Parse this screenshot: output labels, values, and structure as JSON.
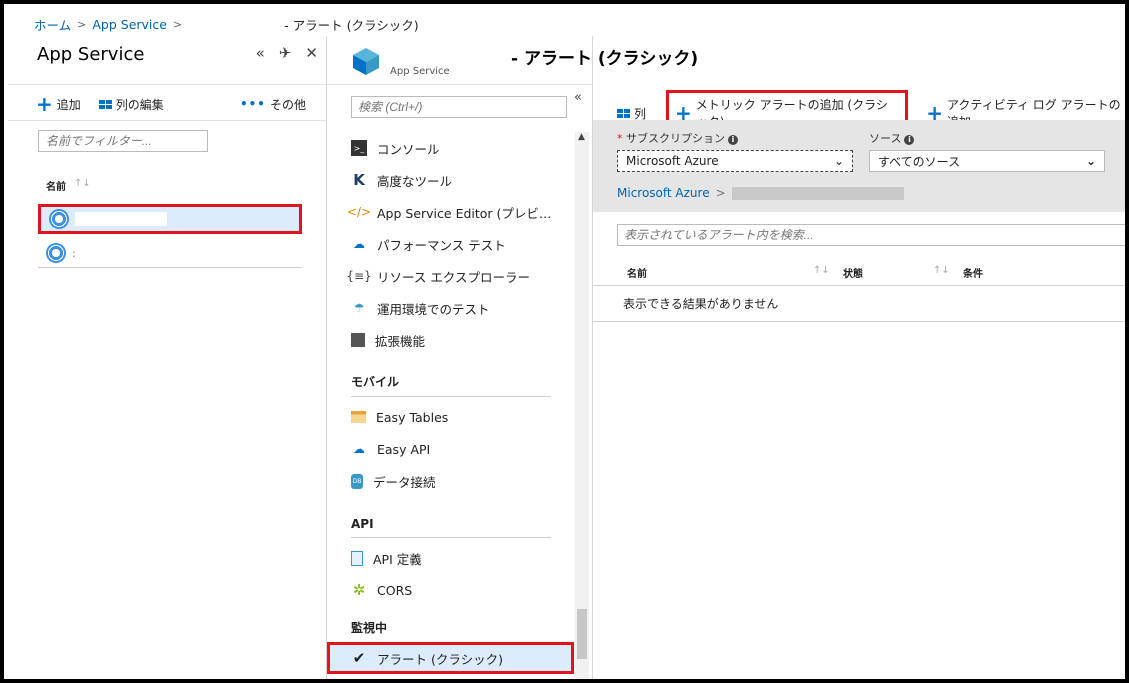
{
  "breadcrumb": {
    "home": "ホーム",
    "app_service": "App Service",
    "current": "- アラート (クラシック)"
  },
  "left_blade": {
    "title": "App Service",
    "toolbar": {
      "add": "追加",
      "edit_columns": "列の編集",
      "more": "その他"
    },
    "filter_placeholder": "名前でフィルター...",
    "column_name": "名前",
    "rows": [
      {
        "name": ""
      },
      {
        "name": ":"
      }
    ]
  },
  "mid_blade": {
    "caption": "App Service",
    "search_placeholder": "検索 (Ctrl+/)",
    "menu": [
      {
        "label": "コンソール",
        "icon": "console-icon"
      },
      {
        "label": "高度なツール",
        "icon": "kudu-icon"
      },
      {
        "label": "App Service Editor (プレビ…",
        "icon": "editor-icon"
      },
      {
        "label": "パフォーマンス テスト",
        "icon": "cloud-icon"
      },
      {
        "label": "リソース エクスプローラー",
        "icon": "explorer-icon"
      },
      {
        "label": "運用環境でのテスト",
        "icon": "test-icon"
      },
      {
        "label": "拡張機能",
        "icon": "extension-icon"
      }
    ],
    "section_mobile": "モバイル",
    "menu_mobile": [
      {
        "label": "Easy Tables",
        "icon": "table-icon"
      },
      {
        "label": "Easy API",
        "icon": "cloud-api-icon"
      },
      {
        "label": "データ接続",
        "icon": "db-icon"
      }
    ],
    "section_api": "API",
    "menu_api": [
      {
        "label": "API 定義",
        "icon": "doc-icon"
      },
      {
        "label": "CORS",
        "icon": "cors-icon"
      }
    ],
    "section_monitor": "監視中",
    "menu_monitor": [
      {
        "label": "アラート (クラシック)",
        "icon": "check-icon"
      }
    ]
  },
  "right_blade": {
    "title": "- アラート (クラシック)",
    "toolbar": {
      "columns": "列",
      "add_metric_alert": "メトリック アラートの追加 (クラシック)",
      "add_activity_log_alert": "アクティビティ ログ アラートの追加"
    },
    "subscription_label": "サブスクリプション",
    "subscription_value": "Microsoft Azure",
    "source_label": "ソース",
    "source_value": "すべてのソース",
    "subscription_link": "Microsoft Azure",
    "alert_search_placeholder": "表示されているアラート内を検索...",
    "table_columns": [
      "名前",
      "状態",
      "条件"
    ],
    "empty_message": "表示できる結果がありません"
  },
  "colors": {
    "accent": "#0072c6",
    "highlight": "#e0141e",
    "selected_bg": "#dcecfc",
    "band_bg": "#e5e5e5"
  }
}
